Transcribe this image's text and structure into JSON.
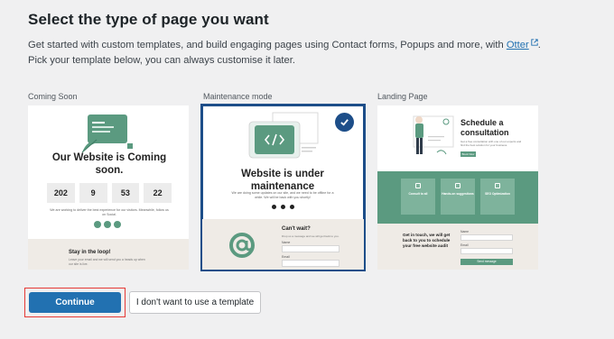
{
  "header": {
    "title": "Select the type of page you want",
    "desc_line1_prefix": "Get started with custom templates, and build engaging pages using Contact forms, Popups and more, with ",
    "otter_link": "Otter",
    "desc_line1_suffix": ".",
    "desc_line2": "Pick your template below, you can always customise it later."
  },
  "cards": {
    "coming_soon": {
      "label": "Coming Soon",
      "heading": "Our Website is Coming soon.",
      "countdown": [
        "202",
        "9",
        "53",
        "22"
      ],
      "note": "We are working to deliver the best experience for our visitors. Meanwhile, follow us on Social.",
      "footer_title": "Stay in the loop!",
      "footer_text": "Leave your email and we will send you a heads up when our site is live."
    },
    "maintenance": {
      "label": "Maintenance mode",
      "heading": "Website is under maintenance",
      "note": "We are doing some updates on our site, and we need to be offline for a while. We will be back with you shortly!",
      "form_title": "Can't wait?",
      "form_sub": "Drop us a message and we will get back to you.",
      "name_label": "Name",
      "email_label": "Email"
    },
    "landing": {
      "label": "Landing Page",
      "heading": "Schedule a consultation",
      "sub": "Get a free consultation with one of our experts and find the best solution for your business.",
      "cta": "Book Now",
      "features": [
        "Consult to all",
        "Hands-on suggestions",
        "SEO Optimization"
      ],
      "contact_heading": "Get in touch, we will get back to you to schedule your free website audit",
      "name_label": "Name",
      "email_label": "Email",
      "send": "Send message"
    }
  },
  "actions": {
    "continue": "Continue",
    "no_template": "I don't want to use a template"
  },
  "colors": {
    "accent_blue": "#2271b1",
    "selection_border": "#1d4e89",
    "template_green": "#5b9a80",
    "highlight_red": "#e53935"
  }
}
